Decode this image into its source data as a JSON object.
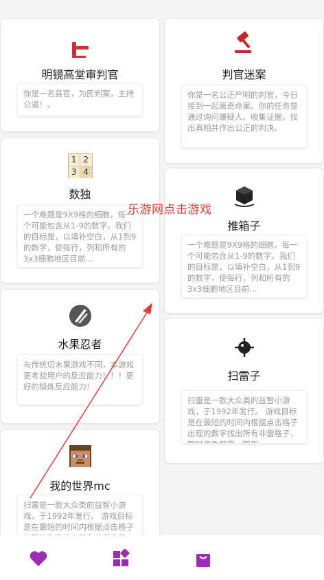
{
  "games": {
    "left": [
      {
        "title": "明镜高堂审判官",
        "desc": "你是一名县官，为民判案，主持公道！。",
        "icon": "gavel-icon"
      },
      {
        "title": "数独",
        "desc": "一个难题是9X9格的细胞，每一个可能包含从1-9的数字。我们的目标是，以填补空白，从1到9的数字，使每行，列和所有的3x3细胞地区目前...",
        "icon": "sudoku-icon",
        "tiles": [
          "1",
          "2",
          "3",
          "4"
        ]
      },
      {
        "title": "水果忍者",
        "desc": "与传统切水果游戏不同，本游戏更考验用户的反应能力！！！更好的锻炼反应能力!",
        "icon": "fruit-ninja-icon"
      },
      {
        "title": "我的世界mc",
        "desc": "扫雷是一款大众类的益智小游戏，于1992年发行。 游戏目标是在最短的时间内根据点击格子出现的数字找出所有非雷格子",
        "icon": "minecraft-steve-icon"
      }
    ],
    "right": [
      {
        "title": "判官迷案",
        "desc": "你是一名公正严明的判官，今日接到一起离奇命案。你的任务是通过询问嫌疑人、收集证据，找出真相并作出公正的判决。",
        "icon": "judge-hammer-icon"
      },
      {
        "title": "推箱子",
        "desc": "一个难题是9X9格的细胞，每一个可能包含从1-9的数字。我们的目标是，以填补空白，从1到9的数字，使每行，列和所有的3x3细胞地区目前...",
        "icon": "push-box-icon"
      },
      {
        "title": "扫雷子",
        "desc": "扫雷是一款大众类的益智小游戏，于1992年发行。 游戏目标是在最短的时间内根据点击格子出现的数字找出所有非雷格子，同时避免踩雷，踩到...",
        "icon": "mine-icon"
      }
    ]
  },
  "watermark": "乐游网点击游戏",
  "tabbar": {
    "tabs": [
      {
        "icon": "heart-icon"
      },
      {
        "icon": "apps-grid-icon"
      },
      {
        "icon": "shopping-bag-icon"
      }
    ]
  },
  "colors": {
    "accent": "#9c2bb5",
    "red": "#c62828",
    "watermark": "#e53935"
  }
}
